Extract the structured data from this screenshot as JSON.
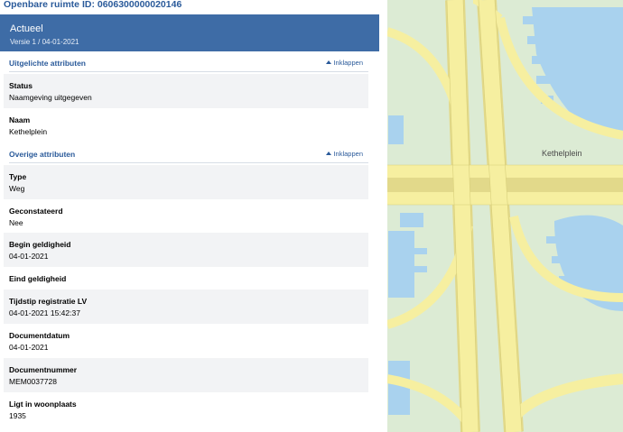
{
  "panel": {
    "title": "Openbare ruimte ID: 0606300000020146",
    "version": {
      "status": "Actueel",
      "meta": "Versie 1 / 04-01-2021"
    },
    "sections": {
      "featured": {
        "label": "Uitgelichte attributen",
        "toggle": "Inklappen"
      },
      "other": {
        "label": "Overige attributen",
        "toggle": "Inklappen"
      }
    },
    "featured_rows": [
      {
        "label": "Status",
        "value": "Naamgeving uitgegeven"
      },
      {
        "label": "Naam",
        "value": "Kethelplein"
      }
    ],
    "other_rows": [
      {
        "label": "Type",
        "value": "Weg"
      },
      {
        "label": "Geconstateerd",
        "value": "Nee"
      },
      {
        "label": "Begin geldigheid",
        "value": "04-01-2021"
      },
      {
        "label": "Eind geldigheid",
        "value": ""
      },
      {
        "label": "Tijdstip registratie LV",
        "value": "04-01-2021 15:42:37"
      },
      {
        "label": "Documentdatum",
        "value": "04-01-2021"
      },
      {
        "label": "Documentnummer",
        "value": "MEM0037728"
      },
      {
        "label": "Ligt in woonplaats",
        "value": "1935"
      }
    ]
  },
  "map": {
    "place_label": "Kethelplein",
    "colors": {
      "land": "#dcebd4",
      "road": "#f6efa0",
      "road_edge": "#e2d98a",
      "water": "#a9d2ee"
    }
  }
}
